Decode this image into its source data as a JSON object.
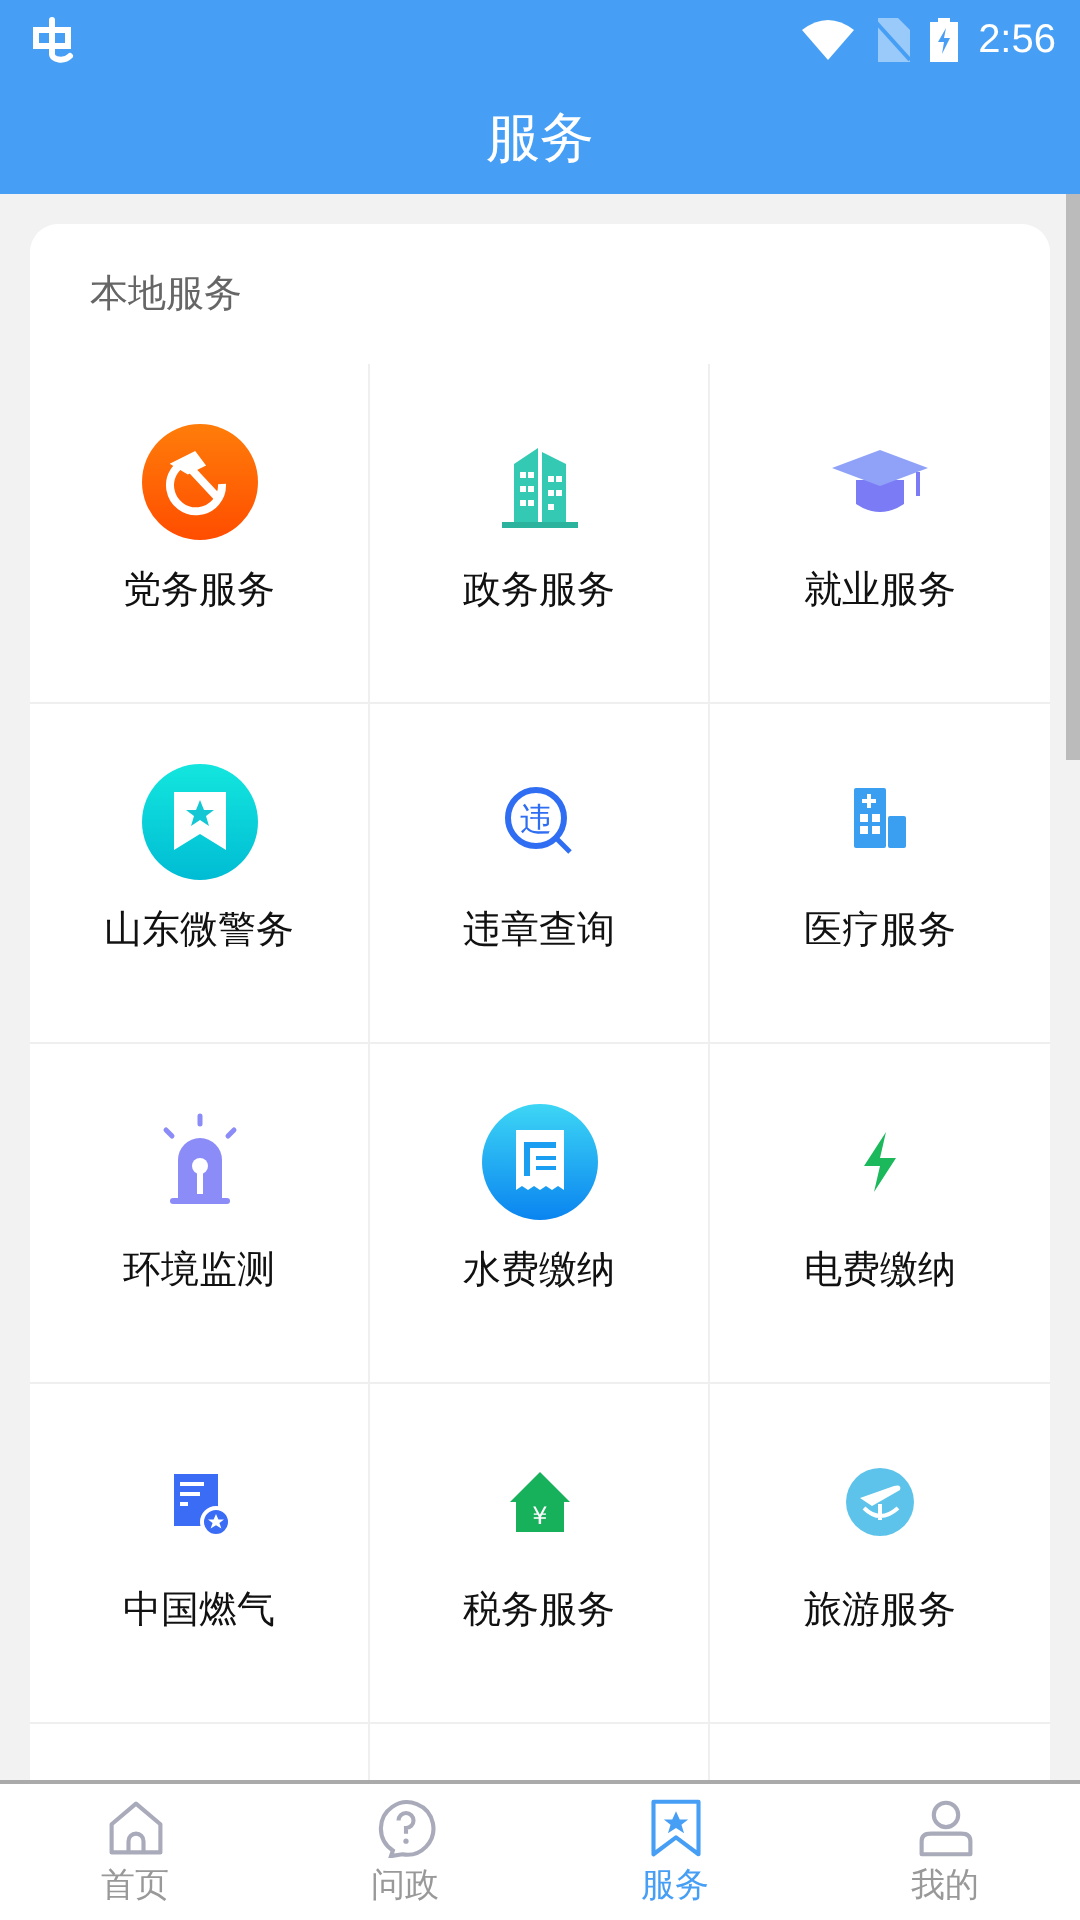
{
  "status_bar": {
    "time": "2:56"
  },
  "header": {
    "title": "服务"
  },
  "section": {
    "title": "本地服务",
    "items": [
      {
        "label": "党务服务",
        "kind": "party"
      },
      {
        "label": "政务服务",
        "kind": "building"
      },
      {
        "label": "就业服务",
        "kind": "graduation"
      },
      {
        "label": "山东微警务",
        "kind": "bookmark"
      },
      {
        "label": "违章查询",
        "kind": "search",
        "glyph": "违"
      },
      {
        "label": "医疗服务",
        "kind": "hospital"
      },
      {
        "label": "环境监测",
        "kind": "alarm"
      },
      {
        "label": "水费缴纳",
        "kind": "receipt"
      },
      {
        "label": "电费缴纳",
        "kind": "bolt"
      },
      {
        "label": "中国燃气",
        "kind": "document"
      },
      {
        "label": "税务服务",
        "kind": "house",
        "glyph": "¥"
      },
      {
        "label": "旅游服务",
        "kind": "plane"
      }
    ]
  },
  "nav": [
    {
      "label": "首页",
      "kind": "home",
      "selected": false
    },
    {
      "label": "问政",
      "kind": "question",
      "selected": false
    },
    {
      "label": "服务",
      "kind": "bookmark",
      "selected": true
    },
    {
      "label": "我的",
      "kind": "user",
      "selected": false
    }
  ]
}
